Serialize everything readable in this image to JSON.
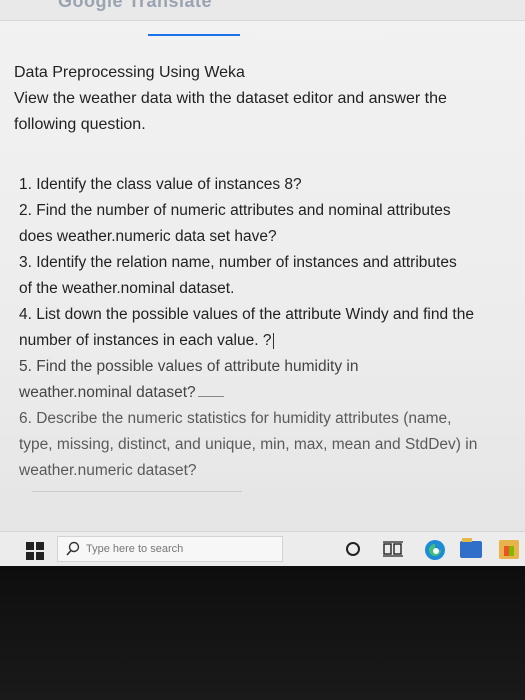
{
  "app": {
    "title": "Google Translate"
  },
  "intro": {
    "line1": "Data Preprocessing Using Weka",
    "line2": "View the weather data with the dataset editor and answer the",
    "line3": "following question."
  },
  "questions": {
    "q1": "1. Identify the class value of instances 8?",
    "q2a": "2. Find the number of numeric attributes and nominal attributes",
    "q2b": "does weather.numeric data set have?",
    "q3a": "3. Identify the relation name, number of instances and attributes",
    "q3b": "of the weather.nominal dataset.",
    "q4a": "4. List down the possible values of the attribute Windy and find the",
    "q4b": "number of instances in each value. ?",
    "q5a": "5. Find the possible values of attribute humidity in",
    "q5b": "weather.nominal dataset?",
    "q6a": "6. Describe the numeric statistics for humidity attributes (name,",
    "q6b": "type, missing, distinct, and unique, min, max, mean and StdDev) in",
    "q6c": "weather.numeric dataset?"
  },
  "taskbar": {
    "search_placeholder": "Type here to search",
    "icons": [
      "windows-start-icon",
      "search-icon",
      "cortana-icon",
      "task-view-icon",
      "edge-icon",
      "file-explorer-icon",
      "store-icon"
    ],
    "accent": "#1a73e8"
  }
}
